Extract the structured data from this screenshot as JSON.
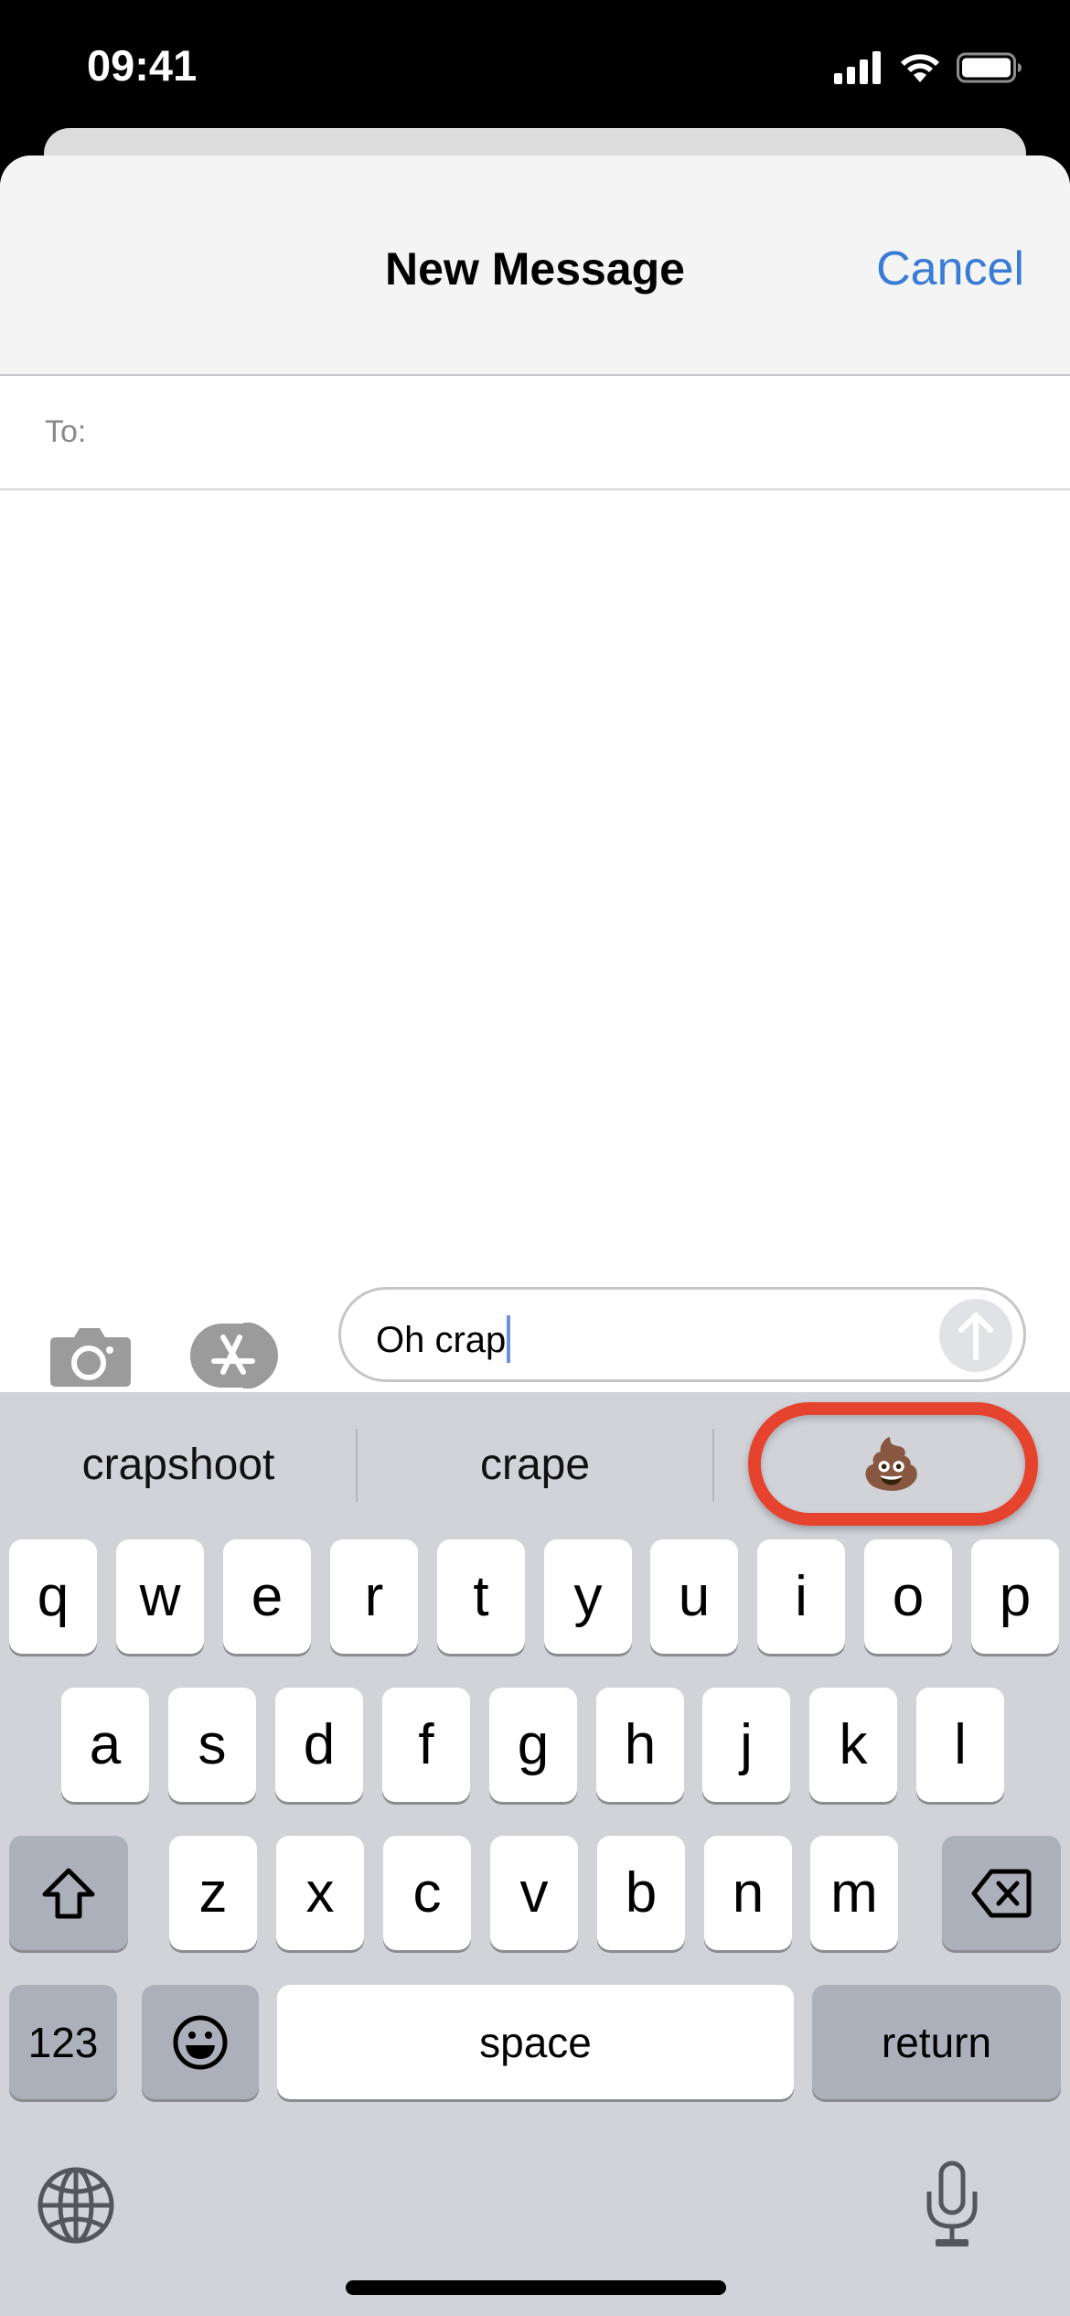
{
  "status_bar": {
    "time": "09:41",
    "icons": [
      "cellular-signal-icon",
      "wifi-icon",
      "battery-icon"
    ]
  },
  "header": {
    "title": "New Message",
    "cancel_label": "Cancel",
    "accent_color": "#3a7bd5"
  },
  "recipient": {
    "label": "To:",
    "value": ""
  },
  "compose": {
    "camera_icon": "camera-icon",
    "apps_icon": "app-store-icon",
    "text": "Oh crap",
    "send_icon": "arrow-up-icon"
  },
  "keyboard": {
    "suggestions": [
      {
        "label": "crapshoot"
      },
      {
        "label": "crape"
      },
      {
        "label": "💩",
        "highlighted": true,
        "highlight_color": "#e5432d"
      }
    ],
    "rows": [
      [
        "q",
        "w",
        "e",
        "r",
        "t",
        "y",
        "u",
        "i",
        "o",
        "p"
      ],
      [
        "a",
        "s",
        "d",
        "f",
        "g",
        "h",
        "j",
        "k",
        "l"
      ],
      [
        "z",
        "x",
        "c",
        "v",
        "b",
        "n",
        "m"
      ]
    ],
    "shift_icon": "shift-icon",
    "delete_icon": "delete-backward-icon",
    "numbers_label": "123",
    "emoji_icon": "emoji-smiley-icon",
    "space_label": "space",
    "return_label": "return",
    "globe_icon": "globe-icon",
    "mic_icon": "microphone-icon"
  }
}
